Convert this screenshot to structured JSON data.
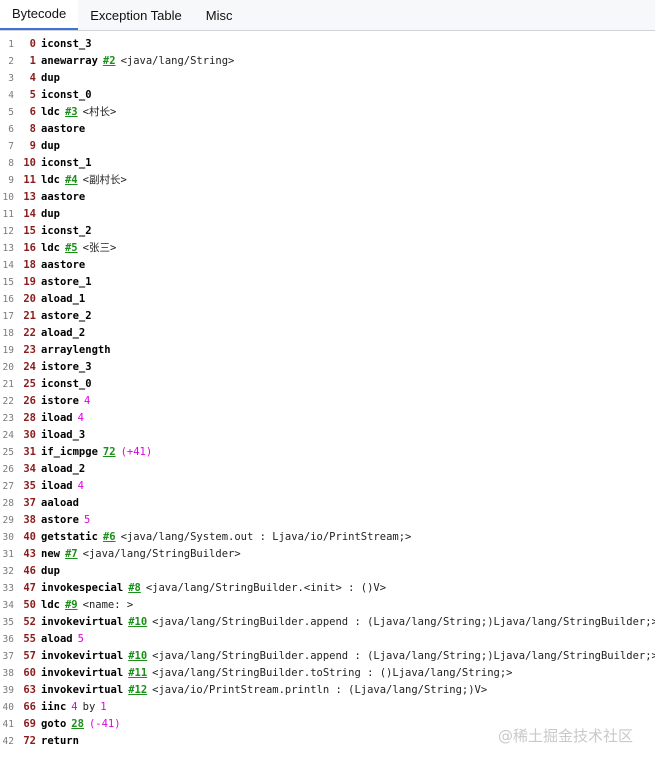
{
  "tabs": [
    "Bytecode",
    "Exception Table",
    "Misc"
  ],
  "active_tab": 0,
  "lines": [
    {
      "ln": "1",
      "off": "0",
      "op": "iconst_3"
    },
    {
      "ln": "2",
      "off": "1",
      "op": "anewarray",
      "ref": "#2",
      "cmt": "<java/lang/String>"
    },
    {
      "ln": "3",
      "off": "4",
      "op": "dup"
    },
    {
      "ln": "4",
      "off": "5",
      "op": "iconst_0"
    },
    {
      "ln": "5",
      "off": "6",
      "op": "ldc",
      "ref": "#3",
      "cmt": "<村长>"
    },
    {
      "ln": "6",
      "off": "8",
      "op": "aastore"
    },
    {
      "ln": "7",
      "off": "9",
      "op": "dup"
    },
    {
      "ln": "8",
      "off": "10",
      "op": "iconst_1"
    },
    {
      "ln": "9",
      "off": "11",
      "op": "ldc",
      "ref": "#4",
      "cmt": "<副村长>"
    },
    {
      "ln": "10",
      "off": "13",
      "op": "aastore"
    },
    {
      "ln": "11",
      "off": "14",
      "op": "dup"
    },
    {
      "ln": "12",
      "off": "15",
      "op": "iconst_2"
    },
    {
      "ln": "13",
      "off": "16",
      "op": "ldc",
      "ref": "#5",
      "cmt": "<张三>"
    },
    {
      "ln": "14",
      "off": "18",
      "op": "aastore"
    },
    {
      "ln": "15",
      "off": "19",
      "op": "astore_1"
    },
    {
      "ln": "16",
      "off": "20",
      "op": "aload_1"
    },
    {
      "ln": "17",
      "off": "21",
      "op": "astore_2"
    },
    {
      "ln": "18",
      "off": "22",
      "op": "aload_2"
    },
    {
      "ln": "19",
      "off": "23",
      "op": "arraylength"
    },
    {
      "ln": "20",
      "off": "24",
      "op": "istore_3"
    },
    {
      "ln": "21",
      "off": "25",
      "op": "iconst_0"
    },
    {
      "ln": "22",
      "off": "26",
      "op": "istore",
      "num": "4"
    },
    {
      "ln": "23",
      "off": "28",
      "op": "iload",
      "num": "4"
    },
    {
      "ln": "24",
      "off": "30",
      "op": "iload_3"
    },
    {
      "ln": "25",
      "off": "31",
      "op": "if_icmpge",
      "ref": "72",
      "jump": "(+41)"
    },
    {
      "ln": "26",
      "off": "34",
      "op": "aload_2"
    },
    {
      "ln": "27",
      "off": "35",
      "op": "iload",
      "num": "4"
    },
    {
      "ln": "28",
      "off": "37",
      "op": "aaload"
    },
    {
      "ln": "29",
      "off": "38",
      "op": "astore",
      "num": "5"
    },
    {
      "ln": "30",
      "off": "40",
      "op": "getstatic",
      "ref": "#6",
      "cmt": "<java/lang/System.out : Ljava/io/PrintStream;>"
    },
    {
      "ln": "31",
      "off": "43",
      "op": "new",
      "ref": "#7",
      "cmt": "<java/lang/StringBuilder>"
    },
    {
      "ln": "32",
      "off": "46",
      "op": "dup"
    },
    {
      "ln": "33",
      "off": "47",
      "op": "invokespecial",
      "ref": "#8",
      "cmt": "<java/lang/StringBuilder.<init> : ()V>"
    },
    {
      "ln": "34",
      "off": "50",
      "op": "ldc",
      "ref": "#9",
      "cmt": "<name: >"
    },
    {
      "ln": "35",
      "off": "52",
      "op": "invokevirtual",
      "ref": "#10",
      "cmt": "<java/lang/StringBuilder.append : (Ljava/lang/String;)Ljava/lang/StringBuilder;>"
    },
    {
      "ln": "36",
      "off": "55",
      "op": "aload",
      "num": "5"
    },
    {
      "ln": "37",
      "off": "57",
      "op": "invokevirtual",
      "ref": "#10",
      "cmt": "<java/lang/StringBuilder.append : (Ljava/lang/String;)Ljava/lang/StringBuilder;>"
    },
    {
      "ln": "38",
      "off": "60",
      "op": "invokevirtual",
      "ref": "#11",
      "cmt": "<java/lang/StringBuilder.toString : ()Ljava/lang/String;>"
    },
    {
      "ln": "39",
      "off": "63",
      "op": "invokevirtual",
      "ref": "#12",
      "cmt": "<java/io/PrintStream.println : (Ljava/lang/String;)V>"
    },
    {
      "ln": "40",
      "off": "66",
      "op": "iinc",
      "num": "4",
      "by": "by",
      "num2": "1"
    },
    {
      "ln": "41",
      "off": "69",
      "op": "goto",
      "ref": "28",
      "jump": "(-41)"
    },
    {
      "ln": "42",
      "off": "72",
      "op": "return"
    }
  ],
  "watermark": "@稀土掘金技术社区",
  "colors": {
    "offset": "#8b1c1c",
    "ref": "#1a8f1a",
    "number": "#e000e0",
    "tab_accent": "#3b73d6"
  }
}
